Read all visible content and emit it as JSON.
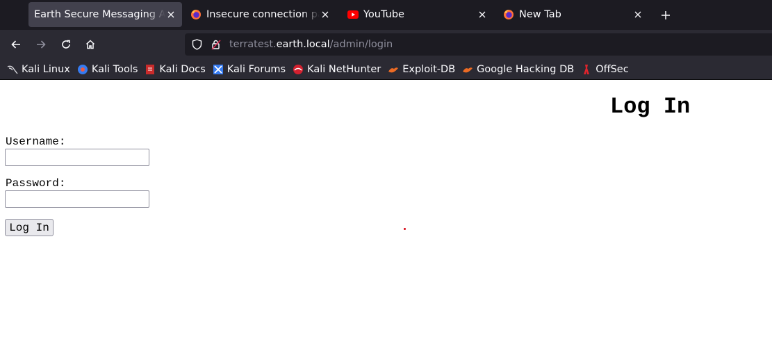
{
  "tabs": [
    {
      "title": "Earth Secure Messaging Admin",
      "icon": "none",
      "active": true
    },
    {
      "title": "Insecure connection password",
      "icon": "firefox-icon",
      "active": false
    },
    {
      "title": "YouTube",
      "icon": "youtube-icon",
      "active": false
    },
    {
      "title": "New Tab",
      "icon": "firefox-icon",
      "active": false
    }
  ],
  "newtab_glyph": "+",
  "close_glyph": "×",
  "nav": {
    "back": "back-arrow-icon",
    "forward": "forward-arrow-icon",
    "reload": "reload-icon",
    "home": "home-icon"
  },
  "url": {
    "prefix": "terratest.",
    "host": "earth.local",
    "path": "/admin/login"
  },
  "bookmarks": [
    {
      "label": "Kali Linux",
      "icon": "kali-dragon-icon"
    },
    {
      "label": "Kali Tools",
      "icon": "kali-tools-icon"
    },
    {
      "label": "Kali Docs",
      "icon": "kali-docs-icon"
    },
    {
      "label": "Kali Forums",
      "icon": "kali-forums-icon"
    },
    {
      "label": "Kali NetHunter",
      "icon": "nethunter-icon"
    },
    {
      "label": "Exploit-DB",
      "icon": "exploitdb-icon"
    },
    {
      "label": "Google Hacking DB",
      "icon": "ghdb-icon"
    },
    {
      "label": "OffSec",
      "icon": "offsec-icon"
    }
  ],
  "page": {
    "heading": "Log In",
    "username_label": "Username:",
    "username_value": "",
    "password_label": "Password:",
    "password_value": "",
    "submit_label": "Log In"
  },
  "colors": {
    "tabstrip_bg": "#1c1b22",
    "toolbar_bg": "#2b2a33",
    "active_tab_bg": "#42414d",
    "text_light": "#fbfbfe",
    "muted": "#8f8f9d"
  }
}
